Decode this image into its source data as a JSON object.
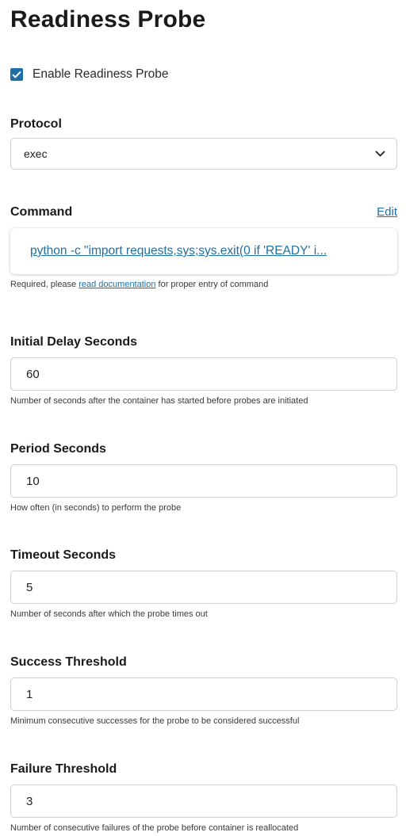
{
  "page_title": "Readiness Probe",
  "enable_probe": {
    "checked": true,
    "label": "Enable Readiness Probe"
  },
  "protocol": {
    "label": "Protocol",
    "value": "exec"
  },
  "command": {
    "label": "Command",
    "edit_label": "Edit",
    "value": "python -c \"import requests,sys;sys.exit(0 if 'READY' i...",
    "help_prefix": "Required, please ",
    "help_link": "read documentation",
    "help_suffix": " for proper entry of command"
  },
  "fields": {
    "initial_delay": {
      "label": "Initial Delay Seconds",
      "value": "60",
      "help": "Number of seconds after the container has started before probes are initiated"
    },
    "period": {
      "label": "Period Seconds",
      "value": "10",
      "help": "How often (in seconds) to perform the probe"
    },
    "timeout": {
      "label": "Timeout Seconds",
      "value": "5",
      "help": "Number of seconds after which the probe times out"
    },
    "success_threshold": {
      "label": "Success Threshold",
      "value": "1",
      "help": "Minimum consecutive successes for the probe to be considered successful"
    },
    "failure_threshold": {
      "label": "Failure Threshold",
      "value": "3",
      "help": "Number of consecutive failures of the probe before container is reallocated"
    }
  },
  "colors": {
    "accent": "#1d6fa5",
    "border": "#d0d0d0",
    "text": "#1f1f1f"
  }
}
